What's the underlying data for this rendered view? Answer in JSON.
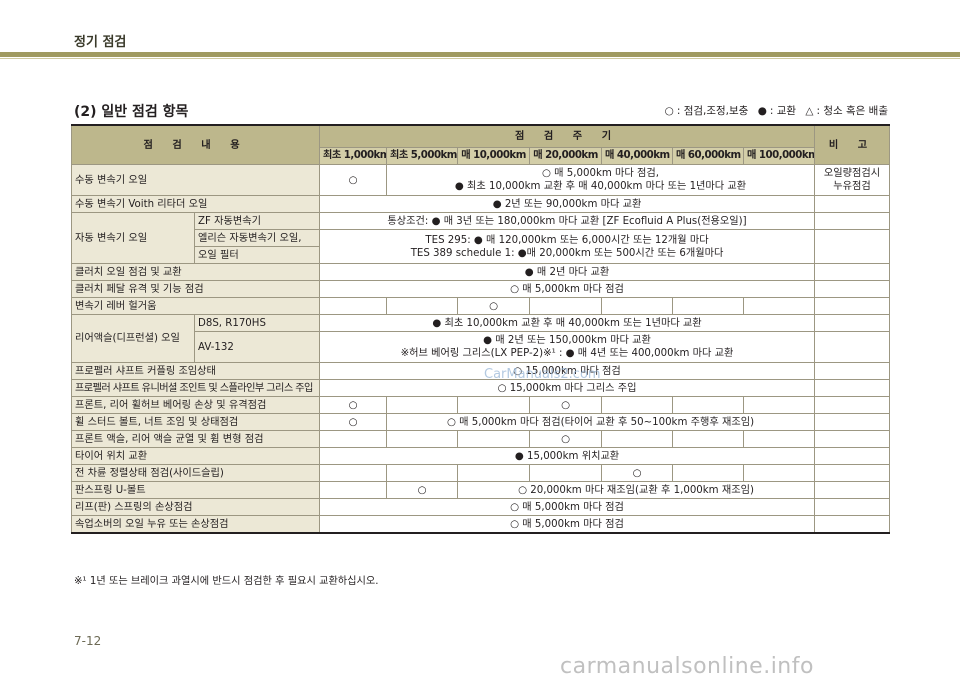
{
  "header": {
    "title": "정기 점검"
  },
  "section": {
    "title": "(2) 일반 점검 항목"
  },
  "legend": {
    "open_symbol": "○",
    "open_text": ": 점검,조정,보충",
    "filled_symbol": "●",
    "filled_text": ": 교환",
    "triangle_symbol": "△",
    "triangle_text": ": 청소 혹은 배출"
  },
  "table": {
    "header": {
      "item": "점 검 내 용",
      "period": "점 검 주 기",
      "note": "비 고"
    },
    "columns": [
      "최초 1,000km",
      "최초 5,000km",
      "매 10,000km",
      "매 20,000km",
      "매 40,000km",
      "매 60,000km",
      "매 100,000km"
    ],
    "rows": [
      {
        "item": "수동 변속기 오일",
        "c1": "○",
        "span_line1": "○ 매 5,000km 마다 점검,",
        "span_line2": "● 최초 10,000km 교환 후 매 40,000km 마다 또는 1년마다 교환",
        "note1": "오일량점검시",
        "note2": "누유점검"
      },
      {
        "item": "수동 변속기 Voith 리타더 오일",
        "span": "● 2년 또는 90,000km 마다 교환"
      },
      {
        "item": "자동 변속기 오일",
        "sub1": "ZF 자동변속기",
        "span1": "통상조건: ● 매 3년 또는 180,000km 마다 교환 [ZF Ecofluid A Plus(전용오일)]",
        "sub2a": "엘리슨 자동변속기 오일,",
        "sub2b": "오일 필터",
        "span2_line1": "TES 295: ● 매 120,000km 또는 6,000시간 또는 12개월 마다",
        "span2_line2": "TES 389 schedule 1: ●매 20,000km 또는 500시간 또는 6개월마다"
      },
      {
        "item": "클러치 오일 점검 및 교환",
        "span": "● 매 2년 마다 교환"
      },
      {
        "item": "클러치 페달 유격 및 기능 점검",
        "span": "○ 매 5,000km 마다 점검"
      },
      {
        "item": "변속기 레버 헐거움",
        "c3": "○"
      },
      {
        "item": "리어액슬(디프런셜) 오일",
        "sub1": "D8S, R170HS",
        "span1": "● 최초 10,000km 교환 후 매 40,000km 또는 1년마다 교환",
        "sub2": "AV-132",
        "span2_line1": "● 매 2년 또는 150,000km 마다 교환",
        "span2_line2": "※허브 베어링 그리스(LX PEP-2)※¹ : ● 매 4년 또는 400,000km 마다 교환"
      },
      {
        "item": "프로펠러 샤프트 커플링 조임상태",
        "span": "○ 15,000km 마다 점검"
      },
      {
        "item": "프로펠러 샤프트 유니버셜 조인트 및 스플라인부 그리스 주입",
        "span": "○ 15,000km 마다 그리스 주입"
      },
      {
        "item": "프론트, 리어 휠허브 베어링 손상 및 유격점검",
        "c1": "○",
        "c4": "○"
      },
      {
        "item": "휠 스터드 볼트, 너트 조임 및 상태점검",
        "c1": "○",
        "span": "○ 매 5,000km 마다 점검(타이어 교환 후 50~100km 주행후 재조임)"
      },
      {
        "item": "프론트 액슬, 리어 액슬 균열 및 휨 변형 점검",
        "c4": "○"
      },
      {
        "item": "타이어 위치 교환",
        "span": "● 15,000km 위치교환"
      },
      {
        "item": "전 차륜 정렬상태 점검(사이드슬립)",
        "c5": "○"
      },
      {
        "item": "판스프링 U-볼트",
        "c2": "○",
        "span": "○ 20,000km 마다 재조임(교환 후 1,000km 재조임)"
      },
      {
        "item": "리프(판) 스프링의 손상점검",
        "span": "○ 매 5,000km 마다 점검"
      },
      {
        "item": "속업소버의 오일 누유 또는 손상점검",
        "span": "○ 매 5,000km 마다 점검"
      }
    ]
  },
  "footnote": "※¹ 1년 또는 브레이크 과열시에 반드시 점검한 후 필요시 교환하십시오.",
  "page_number": "7-12",
  "watermark": {
    "middle": "CarManuals2.com",
    "bottom": "carmanualsonline.info"
  }
}
